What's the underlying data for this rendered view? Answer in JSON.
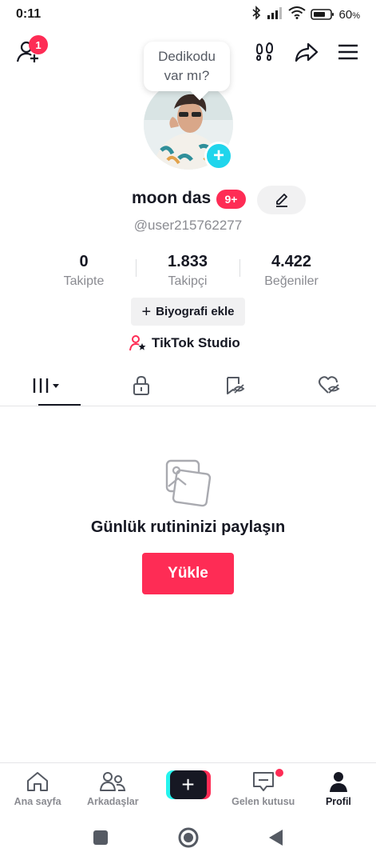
{
  "status_bar": {
    "time": "0:11",
    "battery": "60",
    "battery_unit": "%"
  },
  "top_bar": {
    "friend_requests_count": "1"
  },
  "bubble": {
    "line1": "Dedikodu",
    "line2": "var mı?"
  },
  "profile": {
    "display_name": "moon das",
    "notification_badge": "9+",
    "username": "@user215762277"
  },
  "stats": [
    {
      "value": "0",
      "label": "Takipte"
    },
    {
      "value": "1.833",
      "label": "Takipçi"
    },
    {
      "value": "4.422",
      "label": "Beğeniler"
    }
  ],
  "bio_button": {
    "icon": "+",
    "label": "Biyografi ekle"
  },
  "studio_link": {
    "label": "TikTok Studio"
  },
  "tabs": [
    {
      "icon": "videos-grid-icon",
      "active": true
    },
    {
      "icon": "lock-icon",
      "active": false
    },
    {
      "icon": "bookmark-icon",
      "active": false
    },
    {
      "icon": "liked-heart-icon",
      "active": false
    }
  ],
  "empty_state": {
    "title": "Günlük rutininizi paylaşın",
    "button": "Yükle"
  },
  "bottom_nav": [
    {
      "label": "Ana sayfa",
      "icon": "home-icon"
    },
    {
      "label": "Arkadaşlar",
      "icon": "friends-icon"
    },
    {
      "label": "",
      "icon": "create-plus-icon"
    },
    {
      "label": "Gelen kutusu",
      "icon": "inbox-icon"
    },
    {
      "label": "Profil",
      "icon": "profile-icon",
      "active": true
    }
  ],
  "colors": {
    "accent": "#fe2c55",
    "cyan": "#20d5ec",
    "text": "#161823",
    "muted": "#8a8b91"
  }
}
